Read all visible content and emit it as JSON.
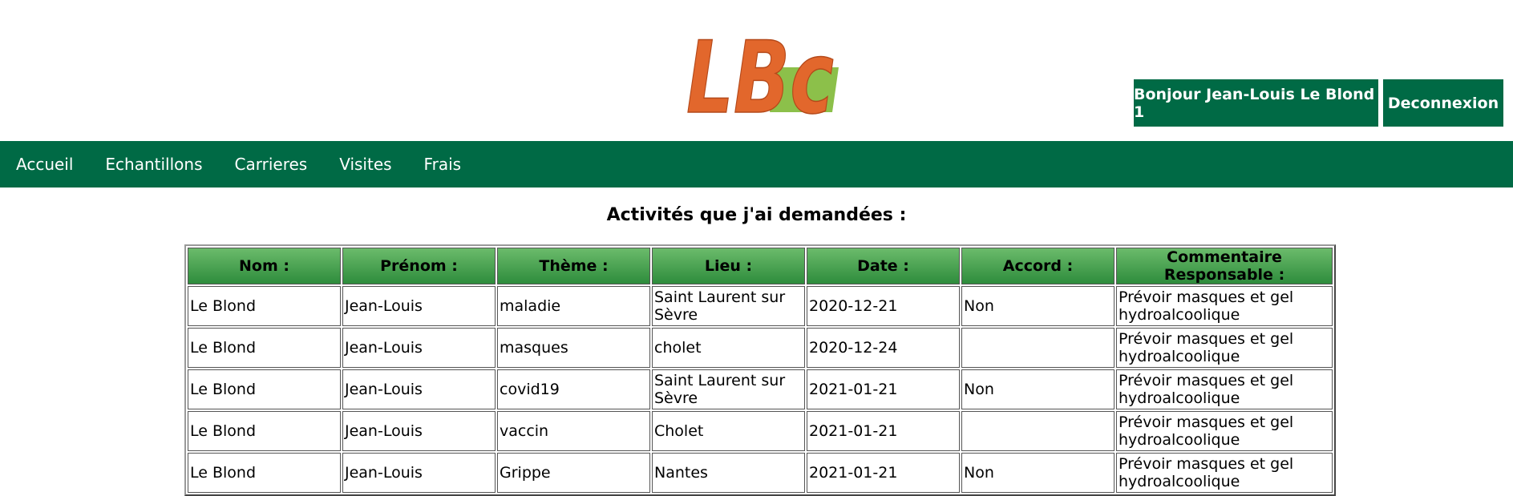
{
  "logo": {
    "text": "LBc"
  },
  "user": {
    "greeting": "Bonjour Jean-Louis Le Blond 1",
    "logout": "Deconnexion"
  },
  "nav": [
    "Accueil",
    "Echantillons",
    "Carrieres",
    "Visites",
    "Frais"
  ],
  "page_title": "Activités que j'ai demandées :",
  "table": {
    "headers": [
      "Nom :",
      "Prénom :",
      "Thème :",
      "Lieu :",
      "Date :",
      "Accord :",
      "Commentaire Responsable :"
    ],
    "rows": [
      [
        "Le Blond",
        "Jean-Louis",
        "maladie",
        "Saint Laurent sur Sèvre",
        "2020-12-21",
        "Non",
        "Prévoir masques et gel hydroalcoolique"
      ],
      [
        "Le Blond",
        "Jean-Louis",
        "masques",
        "cholet",
        "2020-12-24",
        "",
        "Prévoir masques et gel hydroalcoolique"
      ],
      [
        "Le Blond",
        "Jean-Louis",
        "covid19",
        "Saint Laurent sur Sèvre",
        "2021-01-21",
        "Non",
        "Prévoir masques et gel hydroalcoolique"
      ],
      [
        "Le Blond",
        "Jean-Louis",
        "vaccin",
        "Cholet",
        "2021-01-21",
        "",
        "Prévoir masques et gel hydroalcoolique"
      ],
      [
        "Le Blond",
        "Jean-Louis",
        "Grippe",
        "Nantes",
        "2021-01-21",
        "Non",
        "Prévoir masques et gel hydroalcoolique"
      ]
    ]
  },
  "colors": {
    "primary": "#006a45",
    "logo_orange": "#e2672c",
    "logo_green": "#8cc04a"
  }
}
